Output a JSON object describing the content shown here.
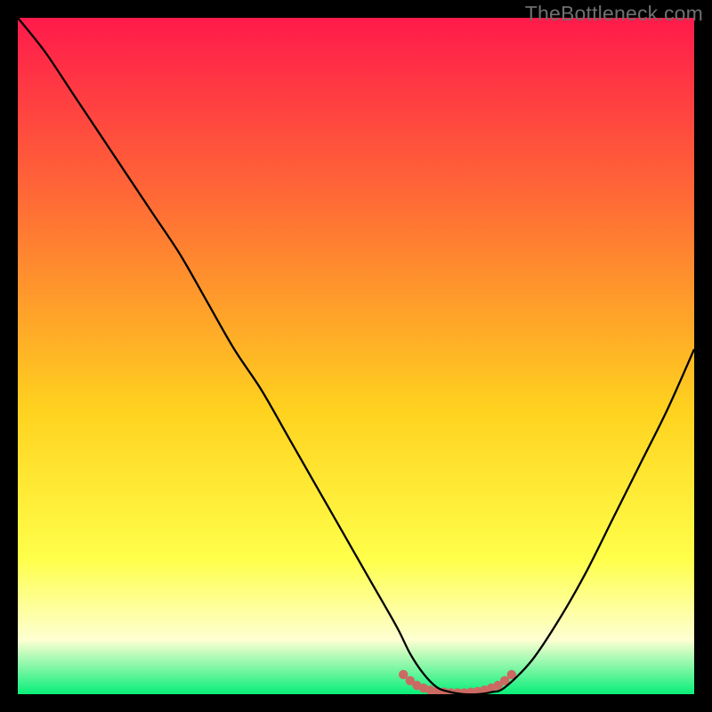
{
  "watermark": "TheBottleneck.com",
  "colors": {
    "gradient_top": "#ff1a4b",
    "gradient_mid_upper": "#ff6e35",
    "gradient_mid": "#ffd21f",
    "gradient_mid_lower": "#ffff4a",
    "gradient_haze": "#fdffd2",
    "gradient_bottom": "#08ef79",
    "curve": "#000000",
    "marker": "#cb6a62",
    "frame": "#000000"
  },
  "chart_data": {
    "type": "line",
    "title": "",
    "xlabel": "",
    "ylabel": "",
    "xlim": [
      0,
      100
    ],
    "ylim": [
      0,
      100
    ],
    "series": [
      {
        "name": "bottleneck-curve",
        "x": [
          0,
          4,
          8,
          12,
          16,
          20,
          24,
          28,
          32,
          36,
          40,
          44,
          48,
          52,
          56,
          58,
          60,
          62,
          64,
          66,
          68,
          70,
          72,
          76,
          80,
          84,
          88,
          92,
          96,
          100
        ],
        "values": [
          100,
          95,
          89,
          83,
          77,
          71,
          65,
          58,
          51,
          45,
          38,
          31,
          24,
          17,
          10,
          6,
          3,
          1,
          0.3,
          0,
          0,
          0.3,
          1,
          5,
          11,
          18,
          26,
          34,
          42,
          51
        ]
      }
    ],
    "markers": {
      "name": "optimal-plateau",
      "type": "scatter",
      "x": [
        57,
        58,
        59,
        60,
        61,
        62,
        63,
        64,
        65,
        66,
        67,
        68,
        69,
        70,
        71,
        72,
        73
      ],
      "values": [
        2.9,
        2.0,
        1.3,
        0.9,
        0.6,
        0.4,
        0.3,
        0.2,
        0.2,
        0.2,
        0.3,
        0.4,
        0.6,
        0.9,
        1.3,
        2.0,
        2.9
      ]
    },
    "axes_visible": false,
    "grid": false
  }
}
